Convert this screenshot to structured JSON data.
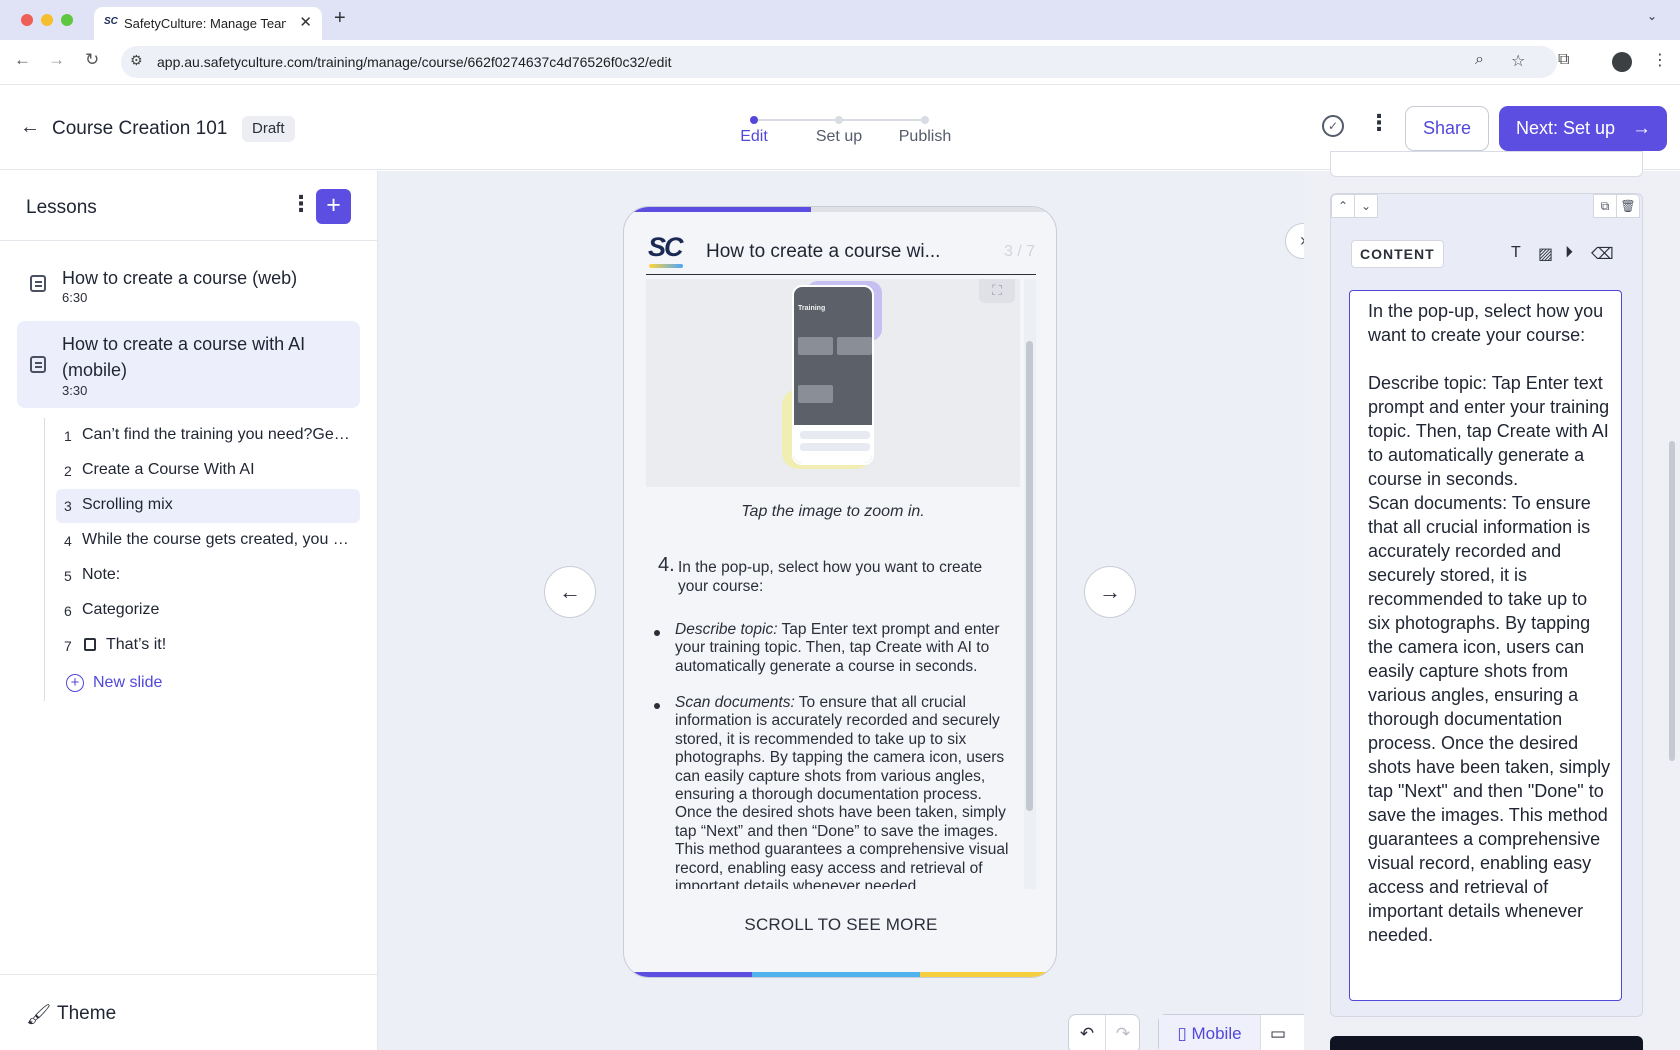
{
  "browser": {
    "tab_title": "SafetyCulture: Manage Teams",
    "tab_favicon": "SC",
    "url": "app.au.safetyculture.com/training/manage/course/662f0274637c4d76526f0c32/edit",
    "icons": [
      "back-icon",
      "forward-icon",
      "reload-icon",
      "site-info-icon",
      "zoom-icon",
      "bookmark-star-icon",
      "extensions-icon",
      "profile-icon",
      "browser-menu-icon"
    ]
  },
  "header": {
    "course_title": "Course Creation 101",
    "status_badge": "Draft",
    "steps": [
      {
        "label": "Edit",
        "active": true
      },
      {
        "label": "Set up",
        "active": false
      },
      {
        "label": "Publish",
        "active": false
      }
    ],
    "share_label": "Share",
    "next_label": "Next: Set up"
  },
  "sidebar": {
    "title": "Lessons",
    "lessons": [
      {
        "title": "How to create a course (web)",
        "duration": "6:30",
        "active": false
      },
      {
        "title": "How to create a course with AI (mobile)",
        "duration": "3:30",
        "active": true
      }
    ],
    "slides": [
      {
        "num": "1",
        "title": "Can’t find the training you need?Generate a course with AI",
        "active": false,
        "locked": false
      },
      {
        "num": "2",
        "title": "Create a Course With AI",
        "active": false,
        "locked": false
      },
      {
        "num": "3",
        "title": "Scrolling mix",
        "active": true,
        "locked": false
      },
      {
        "num": "4",
        "title": "While the course gets created, you can keep working",
        "active": false,
        "locked": false
      },
      {
        "num": "5",
        "title": "Note:",
        "active": false,
        "locked": false
      },
      {
        "num": "6",
        "title": "Categorize",
        "active": false,
        "locked": false
      },
      {
        "num": "7",
        "title": "That’s it!",
        "active": false,
        "locked": true
      }
    ],
    "new_slide_label": "New slide",
    "theme_label": "Theme"
  },
  "preview": {
    "logo_text": "SC",
    "slide_title": "How to create a course wi...",
    "page_count": "3 / 7",
    "progress_fraction": 0.43,
    "mock_screen_title": "Training",
    "caption": "Tap the image to zoom in.",
    "step_number": "4.",
    "step_text": "In the pop-up, select how you want to create your course:",
    "bullets": [
      {
        "label": "Describe topic:",
        "text": " Tap Enter text prompt and enter your training topic. Then, tap Create with AI to automatically generate a course in seconds."
      },
      {
        "label": "Scan documents:",
        "text": " To ensure that all crucial information is accurately recorded and securely stored, it is recommended to take up to six photographs. By tapping the camera icon, users can easily capture shots from various angles, ensuring a thorough documentation process. Once the desired shots have been taken, simply tap “Next” and then “Done” to save the images. This method guarantees a comprehensive visual record, enabling easy access and retrieval of important details whenever needed."
      }
    ],
    "scroll_hint": "SCROLL TO SEE MORE",
    "bottom_progress_colors": [
      "#5b4ee0",
      "#4fb3ee",
      "#f5cf3d"
    ]
  },
  "toolbar": {
    "mode_label": "Mobile"
  },
  "editor": {
    "section_label": "CONTENT",
    "text": "In the pop-up, select how you want to create your course:\n\nDescribe topic: Tap Enter text prompt and enter your training topic. Then, tap Create with AI to automatically generate a course in seconds.\nScan documents: To ensure that all crucial information is accurately recorded and securely stored, it is recommended to take up to six photographs. By tapping the camera icon, users can easily capture shots from various angles, ensuring a thorough documentation process. Once the desired shots have been taken, simply tap \"Next\" and then \"Done\" to save the images. This method guarantees a comprehensive visual record, enabling easy access and retrieval of important details whenever needed."
  },
  "colors": {
    "accent": "#5b4ee0",
    "active_bg": "#edeefc",
    "canvas_bg": "#eceff6"
  }
}
